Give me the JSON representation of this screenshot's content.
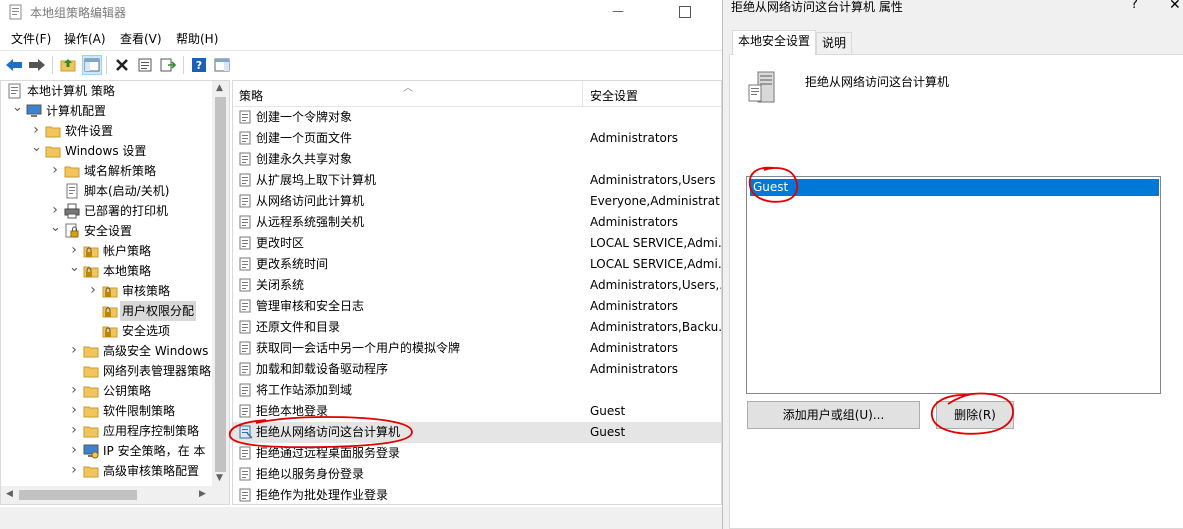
{
  "window": {
    "title": "本地组策略编辑器",
    "minimize_glyph": "—"
  },
  "menu": [
    "文件(F)",
    "操作(A)",
    "查看(V)",
    "帮助(H)"
  ],
  "toolbar": {
    "icons": [
      "back-icon",
      "forward-icon",
      "up-folder-icon",
      "show-hide-tree-icon",
      "delete-icon",
      "properties-icon",
      "export-list-icon",
      "help-icon",
      "show-action-pane-icon"
    ]
  },
  "tree": {
    "items": [
      {
        "label": "本地计算机 策略",
        "level": 0,
        "expander": "",
        "icon": "computer-policy"
      },
      {
        "label": "计算机配置",
        "level": 1,
        "expander": "open",
        "icon": "computer"
      },
      {
        "label": "软件设置",
        "level": 2,
        "expander": "closed",
        "icon": "folder"
      },
      {
        "label": "Windows 设置",
        "level": 2,
        "expander": "open",
        "icon": "folder"
      },
      {
        "label": "域名解析策略",
        "level": 3,
        "expander": "closed",
        "icon": "folder"
      },
      {
        "label": "脚本(启动/关机)",
        "level": 3,
        "expander": "",
        "icon": "script"
      },
      {
        "label": "已部署的打印机",
        "level": 3,
        "expander": "closed",
        "icon": "printer"
      },
      {
        "label": "安全设置",
        "level": 3,
        "expander": "open",
        "icon": "security"
      },
      {
        "label": "帐户策略",
        "level": 4,
        "expander": "closed",
        "icon": "folder-lock"
      },
      {
        "label": "本地策略",
        "level": 4,
        "expander": "open",
        "icon": "folder-lock"
      },
      {
        "label": "审核策略",
        "level": 5,
        "expander": "closed",
        "icon": "folder-lock"
      },
      {
        "label": "用户权限分配",
        "level": 5,
        "expander": "",
        "icon": "folder-lock",
        "selected": true
      },
      {
        "label": "安全选项",
        "level": 5,
        "expander": "",
        "icon": "folder-lock"
      },
      {
        "label": "高级安全 Windows",
        "level": 4,
        "expander": "closed",
        "icon": "folder"
      },
      {
        "label": "网络列表管理器策略",
        "level": 4,
        "expander": "",
        "icon": "folder"
      },
      {
        "label": "公钥策略",
        "level": 4,
        "expander": "closed",
        "icon": "folder"
      },
      {
        "label": "软件限制策略",
        "level": 4,
        "expander": "closed",
        "icon": "folder"
      },
      {
        "label": "应用程序控制策略",
        "level": 4,
        "expander": "closed",
        "icon": "folder"
      },
      {
        "label": "IP 安全策略，在 本",
        "level": 4,
        "expander": "closed",
        "icon": "ipsec"
      },
      {
        "label": "高级审核策略配置",
        "level": 4,
        "expander": "closed",
        "icon": "folder"
      }
    ]
  },
  "list": {
    "columns": [
      "策略",
      "安全设置"
    ],
    "rows": [
      {
        "name": "创建一个令牌对象",
        "value": ""
      },
      {
        "name": "创建一个页面文件",
        "value": "Administrators"
      },
      {
        "name": "创建永久共享对象",
        "value": ""
      },
      {
        "name": "从扩展坞上取下计算机",
        "value": "Administrators,Users"
      },
      {
        "name": "从网络访问此计算机",
        "value": "Everyone,Administrat..."
      },
      {
        "name": "从远程系统强制关机",
        "value": "Administrators"
      },
      {
        "name": "更改时区",
        "value": "LOCAL SERVICE,Admi..."
      },
      {
        "name": "更改系统时间",
        "value": "LOCAL SERVICE,Admi..."
      },
      {
        "name": "关闭系统",
        "value": "Administrators,Users,..."
      },
      {
        "name": "管理审核和安全日志",
        "value": "Administrators"
      },
      {
        "name": "还原文件和目录",
        "value": "Administrators,Backu..."
      },
      {
        "name": "获取同一会话中另一个用户的模拟令牌",
        "value": "Administrators"
      },
      {
        "name": "加载和卸载设备驱动程序",
        "value": "Administrators"
      },
      {
        "name": "将工作站添加到域",
        "value": ""
      },
      {
        "name": "拒绝本地登录",
        "value": "Guest"
      },
      {
        "name": "拒绝从网络访问这台计算机",
        "value": "Guest",
        "selected": true
      },
      {
        "name": "拒绝通过远程桌面服务登录",
        "value": ""
      },
      {
        "name": "拒绝以服务身份登录",
        "value": ""
      },
      {
        "name": "拒绝作为批处理作业登录",
        "value": ""
      }
    ]
  },
  "dialog": {
    "title": "拒绝从网络访问这台计算机 属性",
    "help_glyph": "?",
    "close_glyph": "✕",
    "tabs": [
      "本地安全设置",
      "说明"
    ],
    "policy_name": "拒绝从网络访问这台计算机",
    "users": [
      "Guest"
    ],
    "add_button": "添加用户或组(U)...",
    "remove_button": "删除(R)"
  },
  "colors": {
    "selection_blue": "#0078d7",
    "annotation_red": "#e00000",
    "folder_yellow": "#f2c55c"
  }
}
